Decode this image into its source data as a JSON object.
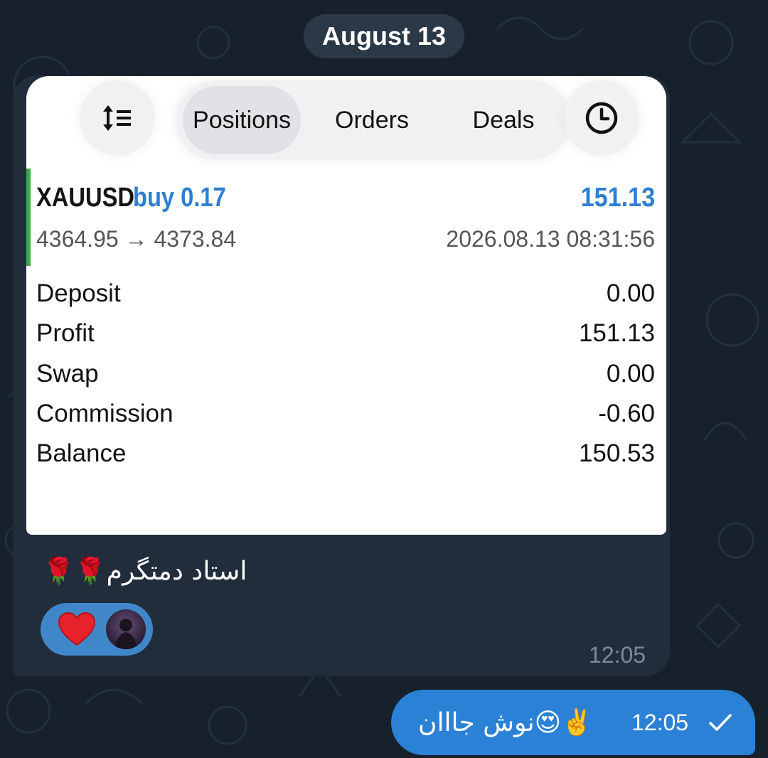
{
  "date_separator": "August 13",
  "screenshot": {
    "tabs": [
      {
        "label": "Positions",
        "active": true
      },
      {
        "label": "Orders",
        "active": false
      },
      {
        "label": "Deals",
        "active": false
      }
    ],
    "icons": {
      "sort": "sort-icon",
      "history": "clock-icon"
    },
    "position": {
      "symbol": "XAUUSD",
      "side": "buy 0.17",
      "profit": "151.13",
      "prices": "4364.95 → 4373.84",
      "time": "2026.08.13 08:31:56"
    },
    "summary": [
      {
        "label": "Deposit",
        "value": "0.00"
      },
      {
        "label": "Profit",
        "value": "151.13"
      },
      {
        "label": "Swap",
        "value": "0.00"
      },
      {
        "label": "Commission",
        "value": "-0.60"
      },
      {
        "label": "Balance",
        "value": "150.53"
      }
    ]
  },
  "incoming": {
    "caption": "استاد دمتگرم🌹🌹",
    "reaction_emoji": "❤️",
    "time": "12:05"
  },
  "outgoing": {
    "text": "نوش جااان😍✌️",
    "time": "12:05",
    "status_icon": "check-icon"
  },
  "colors": {
    "background": "#17212b",
    "incoming_bubble": "#212d3b",
    "outgoing_bubble": "#2b81d6",
    "accent_blue": "#2d7fd1",
    "green": "#3aab4a"
  }
}
